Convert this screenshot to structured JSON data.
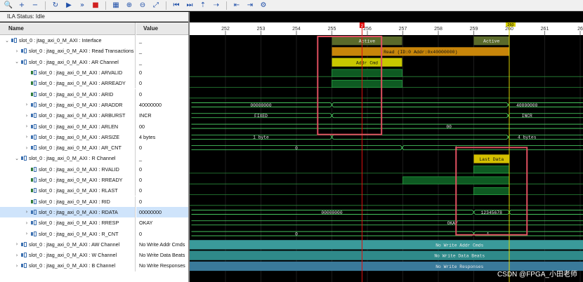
{
  "toolbar": {
    "buttons": [
      "search-icon",
      "plus-icon",
      "minus-icon",
      "refresh-icon",
      "play-icon",
      "fast-forward-icon",
      "stop-icon",
      "grid-icon",
      "zoom-in-icon",
      "zoom-out-icon",
      "zoom-fit-icon",
      "go-to-start-icon",
      "go-to-end-icon",
      "add-marker-icon",
      "next-marker-icon",
      "align-left-icon",
      "align-right-icon",
      "settings-icon"
    ]
  },
  "status": "ILA Status: Idle",
  "columns": {
    "name": "Name",
    "value": "Value"
  },
  "signals": [
    {
      "name": "slot_0 : jtag_axi_0_M_AXI : Interface",
      "value": "_",
      "expander": "⌄",
      "indent": 0,
      "kind": "bus"
    },
    {
      "name": "slot_0 : jtag_axi_0_M_AXI : Read Transactions",
      "value": "_",
      "expander": "›",
      "indent": 1,
      "kind": "bus"
    },
    {
      "name": "slot_0 : jtag_axi_0_M_AXI : AR Channel",
      "value": "_",
      "expander": "⌄",
      "indent": 1,
      "kind": "bus"
    },
    {
      "name": "slot_0 : jtag_axi_0_M_AXI : ARVALID",
      "value": "0",
      "expander": "",
      "indent": 2,
      "kind": "bit"
    },
    {
      "name": "slot_0 : jtag_axi_0_M_AXI : ARREADY",
      "value": "0",
      "expander": "",
      "indent": 2,
      "kind": "bit"
    },
    {
      "name": "slot_0 : jtag_axi_0_M_AXI : ARID",
      "value": "0",
      "expander": "",
      "indent": 2,
      "kind": "bit"
    },
    {
      "name": "slot_0 : jtag_axi_0_M_AXI : ARADDR",
      "value": "40000000",
      "expander": "›",
      "indent": 2,
      "kind": "bus"
    },
    {
      "name": "slot_0 : jtag_axi_0_M_AXI : ARBURST",
      "value": "INCR",
      "expander": "›",
      "indent": 2,
      "kind": "bus"
    },
    {
      "name": "slot_0 : jtag_axi_0_M_AXI : ARLEN",
      "value": "00",
      "expander": "›",
      "indent": 2,
      "kind": "bus"
    },
    {
      "name": "slot_0 : jtag_axi_0_M_AXI : ARSIZE",
      "value": "4 bytes",
      "expander": "›",
      "indent": 2,
      "kind": "bus"
    },
    {
      "name": "slot_0 : jtag_axi_0_M_AXI : AR_CNT",
      "value": "0",
      "expander": "›",
      "indent": 2,
      "kind": "bus"
    },
    {
      "name": "slot_0 : jtag_axi_0_M_AXI : R Channel",
      "value": "_",
      "expander": "⌄",
      "indent": 1,
      "kind": "bus"
    },
    {
      "name": "slot_0 : jtag_axi_0_M_AXI : RVALID",
      "value": "0",
      "expander": "",
      "indent": 2,
      "kind": "bit"
    },
    {
      "name": "slot_0 : jtag_axi_0_M_AXI : RREADY",
      "value": "0",
      "expander": "",
      "indent": 2,
      "kind": "bit"
    },
    {
      "name": "slot_0 : jtag_axi_0_M_AXI : RLAST",
      "value": "0",
      "expander": "",
      "indent": 2,
      "kind": "bit"
    },
    {
      "name": "slot_0 : jtag_axi_0_M_AXI : RID",
      "value": "0",
      "expander": "",
      "indent": 2,
      "kind": "bit"
    },
    {
      "name": "slot_0 : jtag_axi_0_M_AXI : RDATA",
      "value": "00000000",
      "expander": "›",
      "indent": 2,
      "kind": "bus",
      "selected": true
    },
    {
      "name": "slot_0 : jtag_axi_0_M_AXI : RRESP",
      "value": "OKAY",
      "expander": "›",
      "indent": 2,
      "kind": "bus"
    },
    {
      "name": "slot_0 : jtag_axi_0_M_AXI : R_CNT",
      "value": "0",
      "expander": "›",
      "indent": 2,
      "kind": "bus"
    },
    {
      "name": "slot_0 : jtag_axi_0_M_AXI : AW Channel",
      "value": "No Write Addr Cmds",
      "expander": "›",
      "indent": 1,
      "kind": "bus"
    },
    {
      "name": "slot_0 : jtag_axi_0_M_AXI : W Channel",
      "value": "No Write Data Beats",
      "expander": "›",
      "indent": 1,
      "kind": "bus"
    },
    {
      "name": "slot_0 : jtag_axi_0_M_AXI : B Channel",
      "value": "No Write Responses",
      "expander": "›",
      "indent": 1,
      "kind": "bus"
    }
  ],
  "timeline": {
    "ticks": [
      "252",
      "253",
      "254",
      "255",
      "256",
      "257",
      "258",
      "259",
      "260",
      "261",
      "26"
    ],
    "cursor_label": "2",
    "marker_label": "260"
  },
  "waveform_labels": {
    "active_1": "Active",
    "active_2": "Active",
    "read_txn": "Read (ID:0 Addr:0x40000000)",
    "addr_cmd": "Addr Cmd",
    "araddr_before": "00000000",
    "araddr_after": "40000000",
    "arburst_before": "FIXED",
    "arburst_after": "INCR",
    "arlen": "00",
    "arsize_before": "1 byte",
    "arsize_after": "4 bytes",
    "ar_cnt_before": "0",
    "ar_cnt_after": "1",
    "last_data": "Last Data",
    "rdata_before": "00000000",
    "rdata_after": "12345678",
    "rresp": "OKAY",
    "r_cnt_before": "0",
    "r_cnt_after": "1",
    "aw_none": "No Write Addr Cmds",
    "w_none": "No Write Data Beats",
    "b_none": "No Write Responses"
  },
  "watermark": "CSDN @FPGA_小田老师",
  "colors": {
    "active": "#5a6a2a",
    "read_bar": "#c8860a",
    "addr_cmd": "#c8c800",
    "last_data": "#d4c000",
    "signal_high": "#0e5a22",
    "bus_line": "#4fe06a",
    "cursor": "#e01010",
    "highlight_box": "#e05060",
    "teal_bar": "#3a9a9a"
  }
}
